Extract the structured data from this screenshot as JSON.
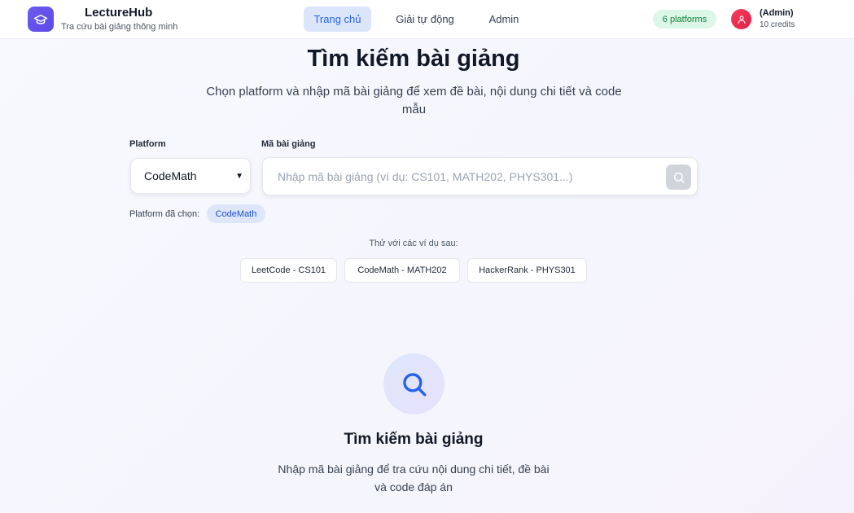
{
  "header": {
    "brand_name": "LectureHub",
    "brand_subtitle": "Tra cứu bài giảng thông minh",
    "logo_icon": "graduation-cap-icon",
    "nav": [
      {
        "label": "Trang chủ",
        "active": true
      },
      {
        "label": "Giải tự động",
        "active": false
      },
      {
        "label": "Admin",
        "active": false
      }
    ],
    "platforms_badge": "6 platforms",
    "user": {
      "name": "(Admin)",
      "credits": "10 credits",
      "avatar_icon": "user-icon"
    }
  },
  "main": {
    "title": "Tìm kiếm bài giảng",
    "subtitle": "Chọn platform và nhập mã bài giảng để xem đề bài, nội dung chi tiết và code mẫu",
    "platform_label": "Platform",
    "platform_selected": "CodeMath",
    "code_label": "Mã bài giảng",
    "search_placeholder": "Nhập mã bài giảng (ví dụ: CS101, MATH202, PHYS301...)",
    "search_icon": "search-icon",
    "selected_platform_label": "Platform đã chọn:",
    "selected_platform_chip": "CodeMath",
    "examples_label": "Thử với các ví dụ sau:",
    "examples": [
      "LeetCode - CS101",
      "CodeMath - MATH202",
      "HackerRank - PHYS301"
    ]
  },
  "empty_state": {
    "icon": "search-icon",
    "title": "Tìm kiếm bài giảng",
    "description": "Nhập mã bài giảng để tra cứu nội dung chi tiết, đề bài và code đáp án"
  },
  "colors": {
    "accent": "#2563eb",
    "brand": "#6d5bf0",
    "success": "#15803d",
    "avatar": "#e11d48"
  }
}
